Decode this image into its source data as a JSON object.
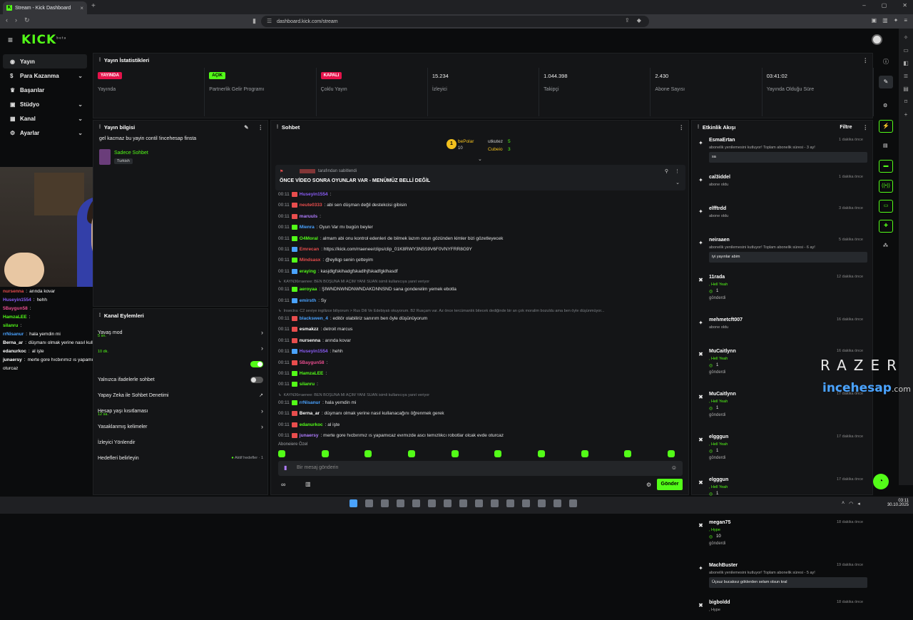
{
  "browser": {
    "tab_title": "Stream - Kick Dashboard",
    "url": "dashboard.kick.com/stream"
  },
  "header": {
    "logo": "KICK",
    "logo_sup": "beta"
  },
  "nav": [
    {
      "label": "Yayın",
      "icon": "broadcast-icon",
      "chev": false,
      "active": true
    },
    {
      "label": "Para Kazanma",
      "icon": "money-icon",
      "chev": true
    },
    {
      "label": "Başarılar",
      "icon": "trophy-icon",
      "chev": false
    },
    {
      "label": "Stüdyo",
      "icon": "studio-icon",
      "chev": true
    },
    {
      "label": "Kanal",
      "icon": "channel-icon",
      "chev": true
    },
    {
      "label": "Ayarlar",
      "icon": "gear-icon",
      "chev": true
    }
  ],
  "stats": {
    "title": "Yayın İstatistikleri",
    "cells": [
      {
        "badge": "YAYINDA",
        "badge_color": "#e5134b",
        "label": "Yayında"
      },
      {
        "badge": "AÇIK",
        "badge_color": "#53fc18",
        "label": "Partnerlik Gelir Programı"
      },
      {
        "badge": "KAPALI",
        "badge_color": "#e5134b",
        "label": "Çoklu Yayın"
      },
      {
        "value": "15.234",
        "label": "İzleyici"
      },
      {
        "value": "1.044.398",
        "label": "Takipçi"
      },
      {
        "value": "2.430",
        "label": "Abone Sayısı"
      },
      {
        "value": "03:41:02",
        "label": "Yayında Olduğu Süre"
      }
    ]
  },
  "yayin_bilgisi": {
    "title": "Yayın bilgisi",
    "stream_title": "gel kacmaz bu yayin contil !incehesap finsta",
    "category": "Sadece Sohbet",
    "tag": "Turkish"
  },
  "cam_chat": [
    {
      "user": "nursenna",
      "color": "#e84d4d",
      "text": "arında kovar"
    },
    {
      "user": "Huseyin1554",
      "color": "#8a5cf6",
      "text": "hehh"
    },
    {
      "user": "5Baygun58",
      "color": "#e84d8f",
      "text": ""
    },
    {
      "user": "HamzaLEE",
      "color": "#53fc18",
      "text": ""
    },
    {
      "user": "silanru",
      "color": "#53fc18",
      "text": ""
    },
    {
      "user": "rrNisanur",
      "color": "#4aa3ff",
      "text": "hala yemdin mi"
    },
    {
      "user": "Berna_ar",
      "color": "#ffffff",
      "text": "düşmanı olmak yerine nasıl kullanacağını öğrenmek gerek"
    },
    {
      "user": "edanurkoc",
      "color": "#ffffff",
      "text": "al işte"
    },
    {
      "user": "junaersy",
      "color": "#ffffff",
      "text": "merte gore hıcbırımız ıs yapamıcaz evımızde ascı temızlıkcı robotlar olcak evde"
    },
    {
      "user": "",
      "color": "#ffffff",
      "text": "oturcaz"
    }
  ],
  "kanal_eylemleri": {
    "title": "Kanal Eylemleri",
    "rows": [
      {
        "label": "Yavaş mod",
        "sub": "5 sn.",
        "control": "arrow"
      },
      {
        "label": "",
        "sub": "10 dk.",
        "control": "arrow"
      },
      {
        "label": "",
        "sub": "",
        "control": "toggle-on"
      },
      {
        "label": "Yalnızca ifadelerle sohbet",
        "sub": "",
        "control": "toggle-off"
      },
      {
        "label": "Yapay Zeka ile Sohbet Denetimi",
        "sub": "",
        "control": "link"
      },
      {
        "label": "Hesap yaşı kısıtlaması",
        "sub": "12 sa.",
        "control": "arrow"
      },
      {
        "label": "Yasaklanmış kelimeler",
        "sub": "",
        "control": "arrow"
      },
      {
        "label": "İzleyici Yönlendir",
        "sub": "",
        "control": "none"
      },
      {
        "label": "Hedefleri belirleyin",
        "sub": "",
        "control": "goal",
        "goal_text": "Aktif hedefler · 1"
      }
    ]
  },
  "sohbet": {
    "title": "Sohbet",
    "leaderboard": [
      {
        "rank": "1",
        "user": "bePolar",
        "count": "10"
      },
      {
        "rank": "",
        "user": "utkutez",
        "count": "5"
      },
      {
        "rank": "",
        "user": "Cubeio",
        "count": "3"
      }
    ],
    "pinned_by": "tarafından sabitlendi",
    "pinned_text": "ÖNCE VİDEO SONRA OYUNLAR VAR - MENÜMÜZ BELLİ DEĞİL",
    "messages": [
      {
        "t": "00:11",
        "user": "Huseyin1554",
        "color": "#8a5cf6",
        "text": ":",
        "badge": "#e84d4d"
      },
      {
        "t": "00:11",
        "user": "neute0333",
        "color": "#e84d4d",
        "text": ": abi sen düşman değil destekcisi gibisin",
        "badge": "#e84d4d"
      },
      {
        "t": "00:11",
        "user": "maruuls",
        "color": "#b07cff",
        "text": ":",
        "badge": "#e84d4d"
      },
      {
        "t": "00:11",
        "user": "Mienra",
        "color": "#4aa3ff",
        "text": ": Oyun Var mı bugün beyler",
        "badge": "#53fc18"
      },
      {
        "t": "00:11",
        "user": "O4Moral",
        "color": "#53fc18",
        "text": ": almam abi onu kontrol edenleri de bilmek lazım onun gözünden kimler bizi gözetleyecek",
        "badge": "#53fc18"
      },
      {
        "t": "00:11",
        "user": "Emrecan",
        "color": "#e84d4d",
        "text": ": https://kick.com/rraenee/clips/clip_01K8RWY3N5S9V6F0VNYFRR8G9Y",
        "badge": "#4aa3ff"
      },
      {
        "t": "00:11",
        "user": "Mindsasx",
        "color": "#e84d4d",
        "text": ": @eyllqp senin çetteyim",
        "badge": "#53fc18"
      },
      {
        "t": "00:11",
        "user": "eraying",
        "color": "#53fc18",
        "text": ": kasjdlgfskihadgfskadlhjfskadfgklhasdf",
        "badge": "#4aa3ff"
      },
      {
        "t": "",
        "user": "",
        "color": "",
        "text": "KAYN36rraenee: BEN BOŞUNA Mİ AÇIM YANİ SUAN isimli kullanıcıya yanıt veriyor",
        "sys": true
      },
      {
        "t": "00:11",
        "user": "aeroyaa",
        "color": "#53fc18",
        "text": ": ŞİWNDNWNDNWNDAKDNNSND sana gonderelim yemek ebotla",
        "badge": "#53fc18"
      },
      {
        "t": "00:11",
        "user": "emirsth",
        "color": "#4aa3ff",
        "text": ": Sy",
        "badge": "#4aa3ff"
      },
      {
        "t": "",
        "user": "",
        "color": "",
        "text": "Insectra: C2 seviye ingilizce biliyorum > Rus Dili Ve Edebiyatı okuyorum. B2 Rusçam var. Az önce tercümanlık bitecek dediğinde bir an çok moralim bozuldu ama ben öyle düşünmüyor...",
        "sys": true
      },
      {
        "t": "00:11",
        "user": "blackswen_4",
        "color": "#4aa3ff",
        "text": ": editör olabiliriz sanırım ben öyle düşünüyorum",
        "badge": "#e84d4d"
      },
      {
        "t": "00:11",
        "user": "esmakzz",
        "color": "#ffffff",
        "text": ": detroit marcus",
        "badge": "#e84d4d"
      },
      {
        "t": "00:11",
        "user": "nursenna",
        "color": "#ffffff",
        "text": ": arında kovar",
        "badge": "#e84d4d"
      },
      {
        "t": "00:11",
        "user": "Huseyin1554",
        "color": "#8a5cf6",
        "text": ": hehh",
        "badge": "#4aa3ff"
      },
      {
        "t": "00:11",
        "user": "5Baygun58",
        "color": "#e84d8f",
        "text": ":",
        "badge": "#e84d4d"
      },
      {
        "t": "00:11",
        "user": "HamzaLEE",
        "color": "#53fc18",
        "text": ":",
        "badge": "#53fc18"
      },
      {
        "t": "00:11",
        "user": "silanru",
        "color": "#53fc18",
        "text": ":",
        "badge": "#53fc18"
      },
      {
        "t": "",
        "user": "",
        "color": "",
        "text": "KAYN36rraenee: BEN BOŞUNA Mİ AÇIM YANİ SUAN isimli kullanıcıya yanıt veriyor",
        "sys": true
      },
      {
        "t": "00:11",
        "user": "rrNisanur",
        "color": "#4aa3ff",
        "text": ": hala yemdin mi",
        "badge": "#53fc18"
      },
      {
        "t": "00:11",
        "user": "Berna_ar",
        "color": "#ffffff",
        "text": ": düşmanı olmak yerine nasıl kullanacağını öğrenmek gerek",
        "badge": "#e84d4d"
      },
      {
        "t": "00:11",
        "user": "edanurkoc",
        "color": "#53fc18",
        "text": ": al işte",
        "badge": "#e84d4d"
      },
      {
        "t": "00:11",
        "user": "junaersy",
        "color": "#b07cff",
        "text": ": merte gore hıcbırımız ıs yapamıcaz evımızde ascı temızlıkcı robotlar olcak evde oturcaz",
        "badge": "#e84d4d"
      }
    ],
    "subscriber_label": "Aboneiere Özel",
    "input_placeholder": "Bir mesaj gönderin",
    "send_label": "Gönder"
  },
  "etkinlik": {
    "title": "Etkinlik Akışı",
    "filter": "Filtre",
    "events": [
      {
        "name": "EsmaErtan",
        "time": "1 dakika önce",
        "desc": "abonelik yenilemesini kutluyor! Toplam abonelik süresi - 3 ay!",
        "msg": "sa",
        "icon": "star-icon"
      },
      {
        "name": "cal3iddel",
        "time": "1 dakika önce",
        "desc": "abone oldu",
        "icon": "star-icon"
      },
      {
        "name": "elfftrdd",
        "time": "3 dakika önce",
        "desc": "abone oldu",
        "icon": "star-icon"
      },
      {
        "name": "neiraaen",
        "time": "5 dakika önce",
        "desc": "abonelik yenilemesini kutluyor! Toplam abonelik süresi - 6 ay!",
        "msg": "iyi yayınlar abim",
        "icon": "star-icon"
      },
      {
        "name": "11rada",
        "time": "12 dakika önce",
        "desc": ", Hell Yeah",
        "count": "1",
        "sent": "gönderdi",
        "icon": "kick-icon"
      },
      {
        "name": "mehmetcft007",
        "time": "16 dakika önce",
        "desc": "abone oldu",
        "icon": "star-icon"
      },
      {
        "name": "MuCaitlynn",
        "time": "16 dakika önce",
        "desc": ", Hell Yeah",
        "count": "1",
        "sent": "gönderdi",
        "icon": "kick-icon"
      },
      {
        "name": "MuCaitlynn",
        "time": "17 dakika önce",
        "desc": ", Hell Yeah",
        "count": "1",
        "sent": "gönderdi",
        "icon": "kick-icon"
      },
      {
        "name": "elgggun",
        "time": "17 dakika önce",
        "desc": ", Hell Yeah",
        "count": "1",
        "sent": "gönderdi",
        "icon": "kick-icon"
      },
      {
        "name": "elgggun",
        "time": "17 dakika önce",
        "desc": ", Hell Yeah",
        "count": "1",
        "sent": "gönderdi",
        "icon": "kick-icon"
      },
      {
        "name": "megan75",
        "time": "18 dakika önce",
        "desc": ", Hype",
        "count": "10",
        "sent": "gönderdi",
        "icon": "kick-icon"
      },
      {
        "name": "MachBuster",
        "time": "19 dakika önce",
        "desc": "abonelik yenilemesini kutluyor! Toplam abonelik süresi - 5 ay!",
        "msg": "Üçsuz bucaksız göklerden selam olsun kral",
        "icon": "star-icon"
      },
      {
        "name": "bigboldd",
        "time": "18 dakika önce",
        "desc": ", Hype",
        "icon": "kick-icon"
      }
    ]
  },
  "overlay": {
    "razer": "RAZER",
    "incehesap": "incehesap",
    "domain": ".com"
  },
  "taskbar": {
    "time": "03:11",
    "date": "30.10.2025"
  },
  "colors": {
    "accent": "#53fc18",
    "live": "#e5134b",
    "panel": "#141517"
  }
}
